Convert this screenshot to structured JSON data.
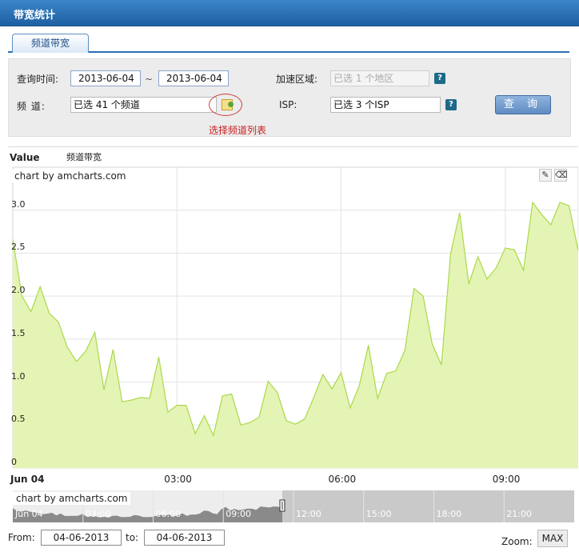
{
  "window": {
    "title": "带宽统计"
  },
  "tabs": [
    {
      "label": "频道带宽"
    }
  ],
  "query": {
    "time_label": "查询时间:",
    "start_date": "2013-06-04",
    "separator": "~",
    "end_date": "2013-06-04",
    "region_label": "加速区域:",
    "region_value": "已选 1 个地区",
    "channel_label": "频 道:",
    "channel_value": "已选 41 个频道",
    "channel_hint": "选择频道列表",
    "isp_label": "ISP:",
    "isp_value": "已选 3 个ISP",
    "search_button": "查 询",
    "help_glyph": "?"
  },
  "icons": {
    "help": "help-icon",
    "channel_picker": "list-picker-icon",
    "zoom_tools": "zoom-tool-icons"
  },
  "chart_data": {
    "type": "area",
    "y_title": "Value",
    "series": [
      {
        "name": "频道带宽",
        "color": "#a9d94a",
        "fill": "#e4f4b4",
        "x": [
          "00:00",
          "00:10",
          "00:20",
          "00:30",
          "00:40",
          "00:50",
          "01:00",
          "01:10",
          "01:20",
          "01:30",
          "01:40",
          "01:50",
          "02:00",
          "02:10",
          "02:20",
          "02:30",
          "02:40",
          "02:50",
          "03:00",
          "03:10",
          "03:20",
          "03:30",
          "03:40",
          "03:50",
          "04:00",
          "04:10",
          "04:20",
          "04:30",
          "04:40",
          "04:50",
          "05:00",
          "05:10",
          "05:20",
          "05:30",
          "05:40",
          "05:50",
          "06:00",
          "06:10",
          "06:20",
          "06:30",
          "06:40",
          "06:50",
          "07:00",
          "07:10",
          "07:20",
          "07:30",
          "07:40",
          "07:50",
          "08:00",
          "08:10",
          "08:20",
          "08:30",
          "08:40",
          "08:50",
          "09:00",
          "09:10",
          "09:20",
          "09:30",
          "09:40",
          "09:50",
          "10:00",
          "10:10",
          "10:20"
        ],
        "values": [
          2.66,
          2.0,
          1.82,
          2.11,
          1.8,
          1.7,
          1.4,
          1.24,
          1.36,
          1.58,
          0.91,
          1.38,
          0.77,
          0.79,
          0.82,
          0.81,
          1.29,
          0.65,
          0.73,
          0.73,
          0.4,
          0.61,
          0.38,
          0.84,
          0.86,
          0.5,
          0.53,
          0.59,
          1.01,
          0.88,
          0.55,
          0.51,
          0.57,
          0.82,
          1.09,
          0.92,
          1.11,
          0.7,
          0.96,
          1.43,
          0.81,
          1.1,
          1.13,
          1.37,
          2.09,
          2.0,
          1.44,
          1.2,
          2.49,
          2.97,
          2.14,
          2.46,
          2.2,
          2.33,
          2.56,
          2.54,
          2.3,
          3.09,
          2.95,
          2.83,
          3.09,
          3.05,
          2.53
        ]
      }
    ],
    "y_ticks": [
      "0",
      "0.5",
      "1.0",
      "1.5",
      "2.0",
      "2.5",
      "3.0"
    ],
    "x_ticks": [
      "Jun 04",
      "03:00",
      "06:00",
      "09:00"
    ],
    "ylim": [
      0,
      3.5
    ],
    "grid": true,
    "credit": "chart by amcharts.com",
    "scrollbar_ticks": [
      "Jun 04",
      "03:00",
      "06:00",
      "09:00",
      "12:00",
      "15:00",
      "18:00",
      "21:00"
    ],
    "scrollbar_selection_fraction": 0.48,
    "range": {
      "from_label": "From:",
      "from_value": "04-06-2013",
      "to_label": "to:",
      "to_value": "04-06-2013",
      "zoom_label": "Zoom:",
      "zoom_max": "MAX"
    }
  }
}
